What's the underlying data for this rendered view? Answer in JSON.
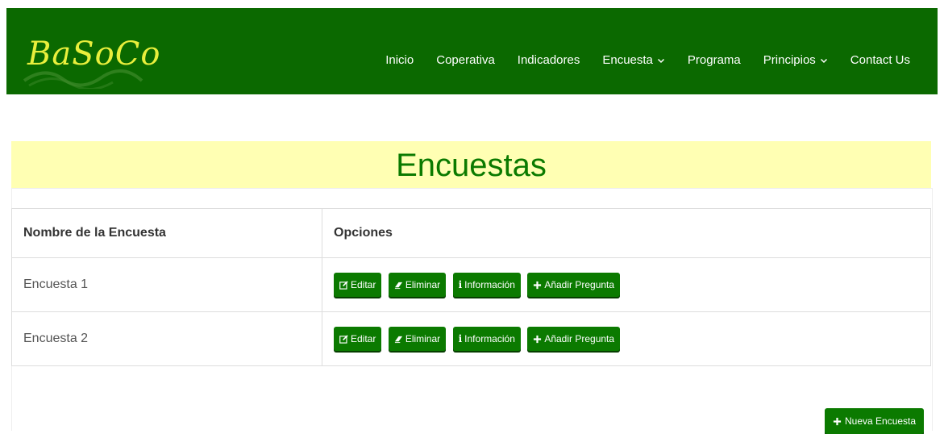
{
  "brand": {
    "text": "BaSoCo"
  },
  "nav": {
    "items": [
      {
        "label": "Inicio",
        "dropdown": false
      },
      {
        "label": "Coperativa",
        "dropdown": false
      },
      {
        "label": "Indicadores",
        "dropdown": false
      },
      {
        "label": "Encuesta",
        "dropdown": true
      },
      {
        "label": "Programa",
        "dropdown": false
      },
      {
        "label": "Principios",
        "dropdown": true
      },
      {
        "label": "Contact Us",
        "dropdown": false
      }
    ]
  },
  "page": {
    "title": "Encuestas"
  },
  "table": {
    "headers": [
      "Nombre de la Encuesta",
      "Opciones"
    ],
    "rows": [
      {
        "name": "Encuesta 1"
      },
      {
        "name": "Encuesta 2"
      }
    ],
    "actions": {
      "edit": "Editar",
      "delete": "Eliminar",
      "info": "Información",
      "add_question": "Añadir Pregunta"
    }
  },
  "new_button": {
    "label": "Nueva Encuesta"
  },
  "colors": {
    "navbar": "#0b6900",
    "accent": "#0b7a00",
    "banner": "#ffffb3",
    "brand": "#e9ef3c"
  }
}
